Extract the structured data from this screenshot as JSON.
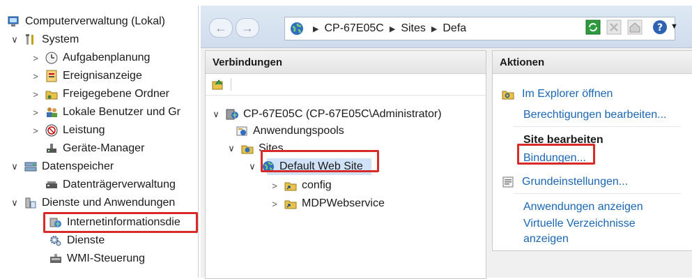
{
  "left_tree": {
    "root": "Computerverwaltung (Lokal)",
    "system": "System",
    "aufgabenplanung": "Aufgabenplanung",
    "ereignisanzeige": "Ereignisanzeige",
    "freigegebene_ordner": "Freigegebene Ordner",
    "lokale_benutzer": "Lokale Benutzer und Gr",
    "leistung": "Leistung",
    "geraete_manager": "Geräte-Manager",
    "datenspeicher": "Datenspeicher",
    "datentraeger": "Datenträgerverwaltung",
    "dienste_anwendungen": "Dienste und Anwendungen",
    "iis": "Internetinformationsdie",
    "dienste": "Dienste",
    "wmi": "WMI-Steuerung"
  },
  "address": {
    "crumb1": "CP-67E05C",
    "crumb2": "Sites",
    "crumb3": "Defa"
  },
  "connections": {
    "header": "Verbindungen",
    "server": "CP-67E05C (CP-67E05C\\Administrator)",
    "app_pools": "Anwendungspools",
    "sites": "Sites",
    "default_site": "Default Web Site",
    "config": "config",
    "mdp": "MDPWebservice"
  },
  "actions": {
    "header": "Aktionen",
    "explorer": "Im Explorer öffnen",
    "permissions": "Berechtigungen bearbeiten...",
    "edit_site": "Site bearbeiten",
    "bindings": "Bindungen...",
    "basic_settings": "Grundeinstellungen...",
    "view_apps": "Anwendungen anzeigen",
    "view_vdirs_line1": "Virtuelle Verzeichnisse",
    "view_vdirs_line2": "anzeigen"
  },
  "colors": {
    "highlight": "#d92a2a",
    "link": "#1a66b3"
  }
}
